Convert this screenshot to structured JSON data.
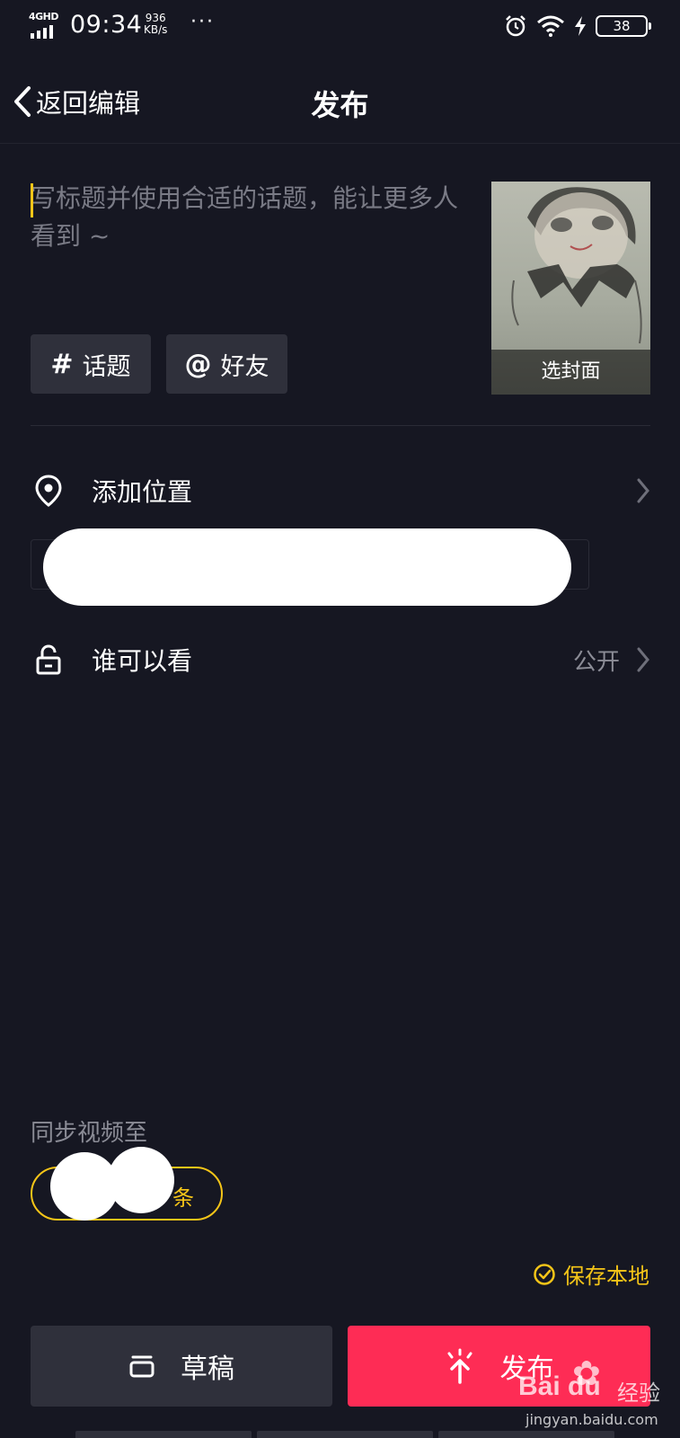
{
  "status_bar": {
    "network": "4GHD",
    "time": "09:34",
    "speed_value": "936",
    "speed_unit": "KB/s",
    "more": "···",
    "battery": "38"
  },
  "header": {
    "back_label": "返回编辑",
    "title": "发布"
  },
  "caption": {
    "placeholder": "写标题并使用合适的话题，能让更多人看到 ~",
    "value": ""
  },
  "cover": {
    "label": "选封面"
  },
  "tags": {
    "topic_symbol": "#",
    "topic_label": "话题",
    "friend_symbol": "@",
    "friend_label": "好友"
  },
  "location": {
    "label": "添加位置"
  },
  "visibility": {
    "label": "谁可以看",
    "value": "公开"
  },
  "sync": {
    "title": "同步视频至",
    "button_label_visible": "条"
  },
  "save_local": {
    "label": "保存本地"
  },
  "actions": {
    "draft_label": "草稿",
    "publish_label": "发布"
  },
  "watermark": {
    "brand": "Bai du",
    "brand_cn": "经验",
    "url": "jingyan.baidu.com"
  },
  "colors": {
    "background": "#161722",
    "accent_yellow": "#f5c518",
    "publish_red": "#fe2c55",
    "chip_bg": "#2f303b"
  }
}
